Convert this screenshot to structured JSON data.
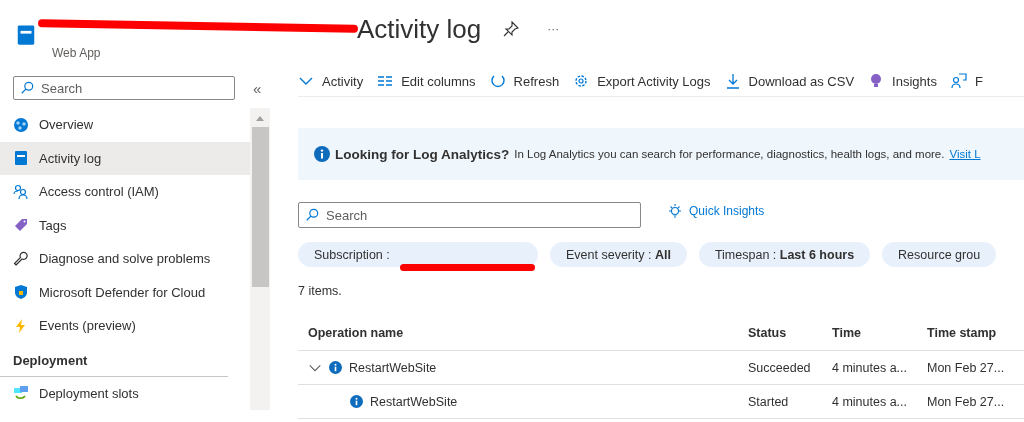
{
  "header": {
    "title": "Activity log",
    "subtitle": "Web App",
    "more": "···"
  },
  "sidebar": {
    "search": {
      "placeholder": "Search"
    },
    "collapse": "«",
    "items": [
      {
        "label": "Overview",
        "selected": false
      },
      {
        "label": "Activity log",
        "selected": true
      },
      {
        "label": "Access control (IAM)",
        "selected": false
      },
      {
        "label": "Tags",
        "selected": false
      },
      {
        "label": "Diagnose and solve problems",
        "selected": false
      },
      {
        "label": "Microsoft Defender for Cloud",
        "selected": false
      },
      {
        "label": "Events (preview)",
        "selected": false
      }
    ],
    "section": "Deployment",
    "section_items": [
      {
        "label": "Deployment slots",
        "selected": false
      }
    ]
  },
  "toolbar": [
    {
      "label": "Activity"
    },
    {
      "label": "Edit columns"
    },
    {
      "label": "Refresh"
    },
    {
      "label": "Export Activity Logs"
    },
    {
      "label": "Download as CSV"
    },
    {
      "label": "Insights"
    },
    {
      "label": "F"
    }
  ],
  "banner": {
    "title": "Looking for Log Analytics?",
    "text": "In Log Analytics you can search for performance, diagnostics, health logs, and more.",
    "link": "Visit L"
  },
  "search": {
    "placeholder": "Search"
  },
  "quick_insights": "Quick Insights",
  "filters": [
    {
      "label": "Subscription :"
    },
    {
      "label": "Event severity :",
      "value": "All"
    },
    {
      "label": "Timespan :",
      "value": "Last 6 hours"
    },
    {
      "label": "Resource grou"
    }
  ],
  "count": "7 items.",
  "table": {
    "columns": [
      "Operation name",
      "Status",
      "Time",
      "Time stamp"
    ],
    "rows": [
      {
        "operation": "RestartWebSite",
        "status": "Succeeded",
        "time": "4 minutes a...",
        "timestamp": "Mon Feb 27...",
        "expanded": true,
        "children": [
          {
            "operation": "RestartWebSite",
            "status": "Started",
            "time": "4 minutes a...",
            "timestamp": "Mon Feb 27..."
          }
        ]
      }
    ]
  }
}
